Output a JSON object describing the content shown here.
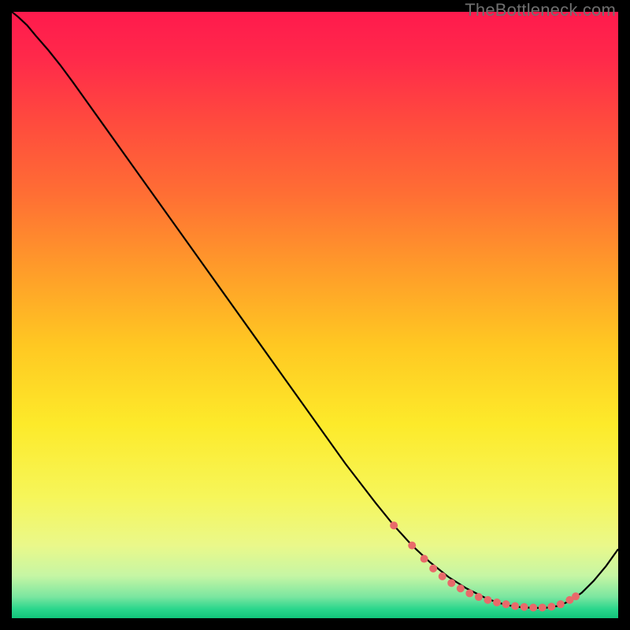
{
  "watermark": "TheBottleneck.com",
  "gradient": {
    "stops": [
      {
        "offset": 0.0,
        "color": "#ff1a4d"
      },
      {
        "offset": 0.08,
        "color": "#ff2a4a"
      },
      {
        "offset": 0.18,
        "color": "#ff4a3e"
      },
      {
        "offset": 0.3,
        "color": "#ff6e34"
      },
      {
        "offset": 0.42,
        "color": "#ff9a2a"
      },
      {
        "offset": 0.55,
        "color": "#ffc822"
      },
      {
        "offset": 0.68,
        "color": "#fdea2a"
      },
      {
        "offset": 0.8,
        "color": "#f6f65a"
      },
      {
        "offset": 0.88,
        "color": "#eaf88a"
      },
      {
        "offset": 0.93,
        "color": "#c6f6a4"
      },
      {
        "offset": 0.965,
        "color": "#7ae6a0"
      },
      {
        "offset": 0.985,
        "color": "#2ad68c"
      },
      {
        "offset": 1.0,
        "color": "#12c47a"
      }
    ]
  },
  "chart_data": {
    "type": "line",
    "title": "",
    "xlabel": "",
    "ylabel": "",
    "xlim": [
      0,
      100
    ],
    "ylim": [
      0,
      100
    ],
    "series": [
      {
        "name": "curve",
        "x": [
          0,
          1,
          2.5,
          4,
          6,
          8,
          10,
          15,
          20,
          25,
          30,
          35,
          40,
          45,
          50,
          55,
          60,
          63,
          66,
          69,
          72,
          75,
          78,
          80,
          82,
          84,
          86,
          88,
          90,
          92,
          94,
          96,
          98,
          100
        ],
        "y": [
          100,
          99.2,
          97.8,
          96,
          93.7,
          91.2,
          88.5,
          81.5,
          74.5,
          67.5,
          60.5,
          53.5,
          46.5,
          39.5,
          32.5,
          25.5,
          19,
          15.3,
          12,
          9.2,
          6.8,
          4.9,
          3.4,
          2.6,
          2.1,
          1.8,
          1.7,
          1.7,
          2.0,
          2.8,
          4.2,
          6.2,
          8.6,
          11.4
        ]
      }
    ],
    "markers": {
      "comment": "red dotted markers near trough",
      "color": "#e86a6a",
      "points": [
        {
          "x": 63,
          "y": 15.3
        },
        {
          "x": 66,
          "y": 12.0
        },
        {
          "x": 68,
          "y": 9.8
        },
        {
          "x": 69.5,
          "y": 8.2
        },
        {
          "x": 71,
          "y": 6.9
        },
        {
          "x": 72.5,
          "y": 5.8
        },
        {
          "x": 74,
          "y": 4.9
        },
        {
          "x": 75.5,
          "y": 4.1
        },
        {
          "x": 77,
          "y": 3.5
        },
        {
          "x": 78.5,
          "y": 3.0
        },
        {
          "x": 80,
          "y": 2.6
        },
        {
          "x": 81.5,
          "y": 2.3
        },
        {
          "x": 83,
          "y": 2.0
        },
        {
          "x": 84.5,
          "y": 1.85
        },
        {
          "x": 86,
          "y": 1.75
        },
        {
          "x": 87.5,
          "y": 1.75
        },
        {
          "x": 89,
          "y": 1.9
        },
        {
          "x": 90.5,
          "y": 2.3
        },
        {
          "x": 92,
          "y": 3.0
        },
        {
          "x": 93,
          "y": 3.6
        }
      ]
    },
    "y_inverted_note": "y=0 is bottom (green), y=100 is top (red). Curve starts top-left, descends to a trough near x≈86, rises slightly to the right edge."
  }
}
